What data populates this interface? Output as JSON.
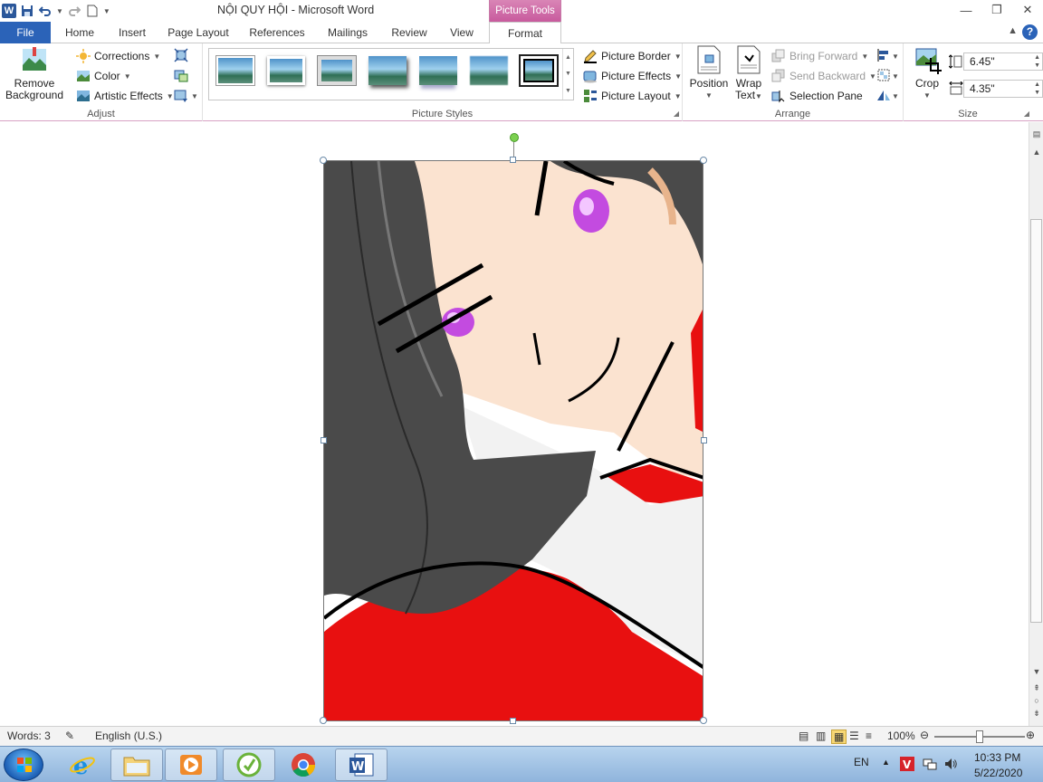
{
  "window": {
    "document_name": "NỘI QUY HỘI",
    "app_name": "Microsoft Word",
    "title_separator": " - ",
    "contextual_tab_group": "Picture Tools"
  },
  "tabs": [
    {
      "label": "File"
    },
    {
      "label": "Home"
    },
    {
      "label": "Insert"
    },
    {
      "label": "Page Layout"
    },
    {
      "label": "References"
    },
    {
      "label": "Mailings"
    },
    {
      "label": "Review"
    },
    {
      "label": "View"
    },
    {
      "label": "Format"
    }
  ],
  "ribbon": {
    "adjust": {
      "label": "Adjust",
      "remove_background_line1": "Remove",
      "remove_background_line2": "Background",
      "corrections": "Corrections",
      "color": "Color",
      "artistic_effects": "Artistic Effects"
    },
    "picture_styles": {
      "label": "Picture Styles",
      "picture_border": "Picture Border",
      "picture_effects": "Picture Effects",
      "picture_layout": "Picture Layout"
    },
    "arrange": {
      "label": "Arrange",
      "position": "Position",
      "wrap_text_line1": "Wrap",
      "wrap_text_line2": "Text",
      "bring_forward": "Bring Forward",
      "send_backward": "Send Backward",
      "selection_pane": "Selection Pane"
    },
    "size": {
      "label": "Size",
      "crop": "Crop",
      "height": "6.45\"",
      "width": "4.35\""
    }
  },
  "statusbar": {
    "words": "Words: 3",
    "language": "English (U.S.)",
    "zoom": "100%"
  },
  "taskbar": {
    "input_language": "EN",
    "time": "10:33 PM",
    "date": "5/22/2020"
  },
  "colors": {
    "file_tab": "#2b63b8",
    "contextual_tab": "#c85a9d",
    "hair": "#4a4a4a",
    "skin": "#fbe3d0",
    "eye": "#c34be0",
    "shirt": "#e81010"
  }
}
